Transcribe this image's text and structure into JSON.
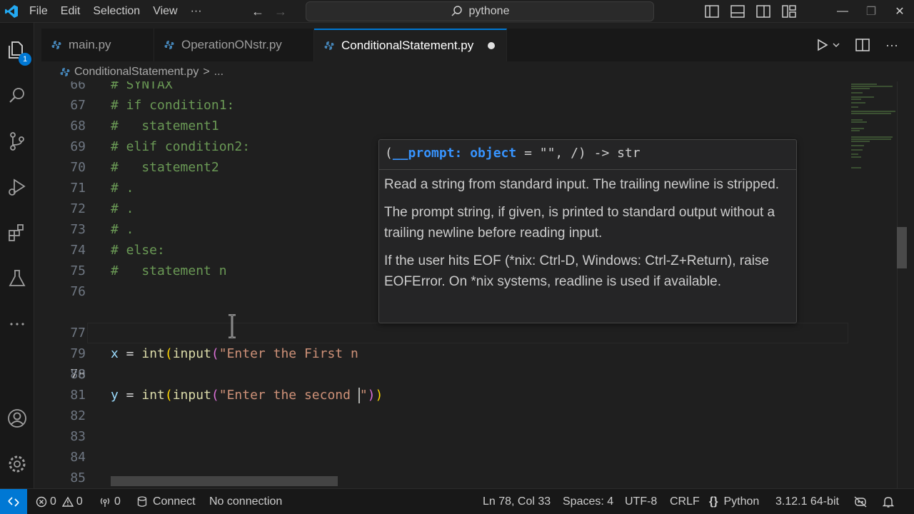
{
  "menu": [
    "File",
    "Edit",
    "Selection",
    "View",
    "···"
  ],
  "search": {
    "text": "pythone"
  },
  "tabs": [
    {
      "label": "main.py",
      "active": false
    },
    {
      "label": "OperationONstr.py",
      "active": false
    },
    {
      "label": "ConditionalStatement.py",
      "active": true,
      "dirty": true
    }
  ],
  "breadcrumb": {
    "file": "ConditionalStatement.py",
    "sep": ">",
    "more": "..."
  },
  "activity": {
    "explorer_badge": "1"
  },
  "editor": {
    "lines": [
      {
        "n": "66",
        "text": "# SYNTAX"
      },
      {
        "n": "67",
        "text": "# if condition1:"
      },
      {
        "n": "68",
        "text": "#   statement1"
      },
      {
        "n": "69",
        "text": "# elif condition2:"
      },
      {
        "n": "70",
        "text": "#   statement2"
      },
      {
        "n": "71",
        "text": "# ."
      },
      {
        "n": "72",
        "text": "# ."
      },
      {
        "n": "73",
        "text": "# ."
      },
      {
        "n": "74",
        "text": "# else:"
      },
      {
        "n": "75",
        "text": "#   statement n"
      },
      {
        "n": "76",
        "text": ""
      },
      {
        "n": "77",
        "var": "x",
        "eq": " = ",
        "f1": "int",
        "p1": "(",
        "f2": "input",
        "p2": "(",
        "s": "\"Enter the First n",
        "tail": ""
      },
      {
        "n": "78",
        "var": "y",
        "eq": " = ",
        "f1": "int",
        "p1": "(",
        "f2": "input",
        "p2": "(",
        "s": "\"Enter the second ",
        "q": "\"",
        "c1": ")",
        "c2": ")"
      },
      {
        "n": "79"
      },
      {
        "n": "80"
      },
      {
        "n": "81"
      },
      {
        "n": "82"
      },
      {
        "n": "83"
      },
      {
        "n": "84"
      },
      {
        "n": "85"
      }
    ]
  },
  "hover": {
    "sig_open": "(",
    "sig_param": "__prompt: object",
    "sig_rest": " = \"\", /) -> str",
    "doc1": "Read a string from standard input. The trailing newline is stripped.",
    "doc2": "The prompt string, if given, is printed to standard output without a trailing newline before reading input.",
    "doc3": "If the user hits EOF (*nix: Ctrl-D, Windows: Ctrl-Z+Return), raise EOFError. On *nix systems, readline is used if available."
  },
  "status": {
    "errors": "0",
    "warnings": "0",
    "ports": "0",
    "connect": "Connect",
    "connection": "No connection",
    "position": "Ln 78, Col 33",
    "spaces": "Spaces: 4",
    "encoding": "UTF-8",
    "eol": "CRLF",
    "language": "Python",
    "interpreter": "3.12.1 64-bit"
  },
  "colors": {
    "accent": "#0078d4",
    "comment": "#6a9955",
    "string": "#ce9178",
    "function": "#dcdcaa",
    "variable": "#9cdcfe"
  }
}
